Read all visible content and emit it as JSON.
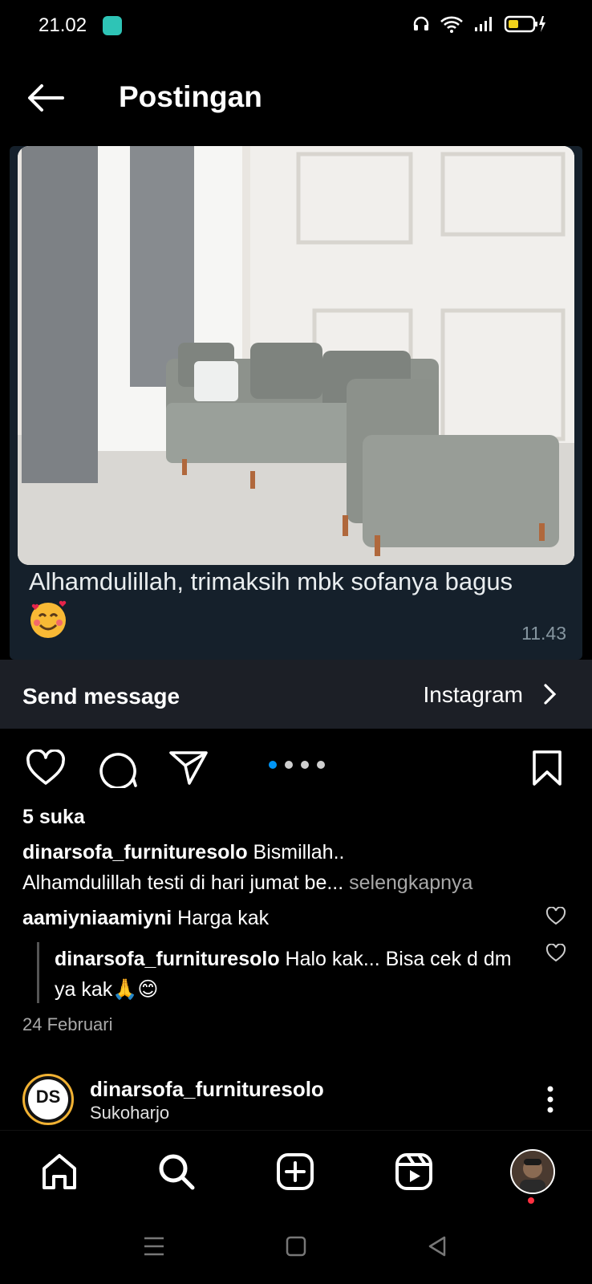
{
  "status_bar": {
    "time": "21.02"
  },
  "header": {
    "title": "Postingan"
  },
  "post_media": {
    "message_text": "Alhamdulillah, trimaksih mbk sofanya bagus",
    "message_time": "11.43",
    "carousel_total": 4,
    "carousel_active": 1
  },
  "send_bar": {
    "send_label": "Send message",
    "platform_label": "Instagram"
  },
  "post": {
    "likes": "5 suka",
    "author": "dinarsofa_furnituresolo",
    "caption_line1": "Bismillah..",
    "caption_line2": "Alhamdulillah testi di hari jumat be...",
    "see_more": "selengkapnya",
    "comments": [
      {
        "user": "aamiyniaamiyni",
        "text": "Harga kak"
      },
      {
        "user": "dinarsofa_furnituresolo",
        "text": "Halo kak... Bisa cek d dm ya kak🙏😊"
      }
    ],
    "date": "24 Februari"
  },
  "next_post": {
    "username": "dinarsofa_furnituresolo",
    "location": "Sukoharjo",
    "avatar_text": "DS"
  },
  "colors": {
    "accent": "#0095f6",
    "notification": "#ff3040",
    "bubble": "#15202b"
  },
  "icons": [
    "back-arrow-icon",
    "heart-icon",
    "comment-icon",
    "share-icon",
    "bookmark-icon",
    "home-icon",
    "search-icon",
    "create-icon",
    "reels-icon",
    "more-icon"
  ]
}
